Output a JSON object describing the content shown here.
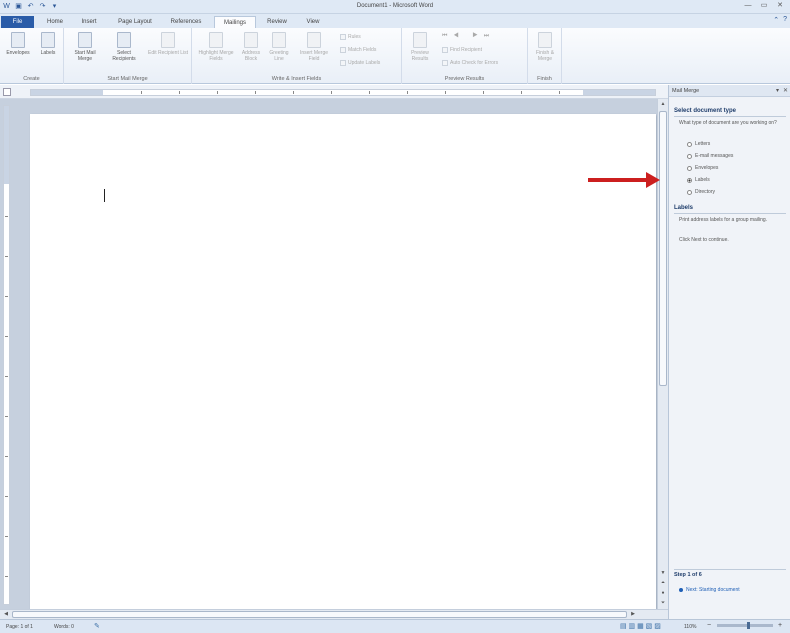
{
  "window": {
    "title": "Document1 - Microsoft Word",
    "qat_icons": [
      "word-icon",
      "save-icon",
      "undo-icon",
      "redo-icon",
      "customize-icon"
    ],
    "controls": [
      "minimize-icon",
      "maximize-icon",
      "close-icon"
    ]
  },
  "tabs": {
    "file": "File",
    "items": [
      "Home",
      "Insert",
      "Page Layout",
      "References",
      "Mailings",
      "Review",
      "View"
    ],
    "active": "Mailings"
  },
  "ribbon": {
    "create": {
      "label": "Create",
      "envelopes": "Envelopes",
      "labels": "Labels"
    },
    "start_mail_merge": {
      "label": "Start Mail Merge",
      "start": "Start Mail Merge",
      "select_recipients": "Select Recipients",
      "edit_list": "Edit Recipient List"
    },
    "write_insert": {
      "label": "Write & Insert Fields",
      "highlight": "Highlight Merge Fields",
      "address_block": "Address Block",
      "greeting_line": "Greeting Line",
      "insert_merge_field": "Insert Merge Field",
      "rules": "Rules",
      "match_fields": "Match Fields",
      "update_labels": "Update Labels"
    },
    "preview": {
      "label": "Preview Results",
      "preview_results": "Preview Results",
      "find_recipient": "Find Recipient",
      "auto_check": "Auto Check for Errors"
    },
    "finish": {
      "label": "Finish",
      "finish_merge": "Finish & Merge"
    }
  },
  "taskpane": {
    "title": "Mail Merge",
    "select_heading": "Select document type",
    "question": "What type of document are you working on?",
    "options": [
      "Letters",
      "E-mail messages",
      "Envelopes",
      "Labels",
      "Directory"
    ],
    "selected": "Labels",
    "labels_heading": "Labels",
    "labels_desc": "Print address labels for a group mailing.",
    "continue_text": "Click Next to continue.",
    "step": "Step 1 of 6",
    "next_link": "Next: Starting document"
  },
  "status": {
    "page": "Page: 1 of 1",
    "words": "Words: 0",
    "zoom": "110%"
  },
  "colors": {
    "accent": "#2a5ca8",
    "arrow": "#cc1f1f"
  }
}
